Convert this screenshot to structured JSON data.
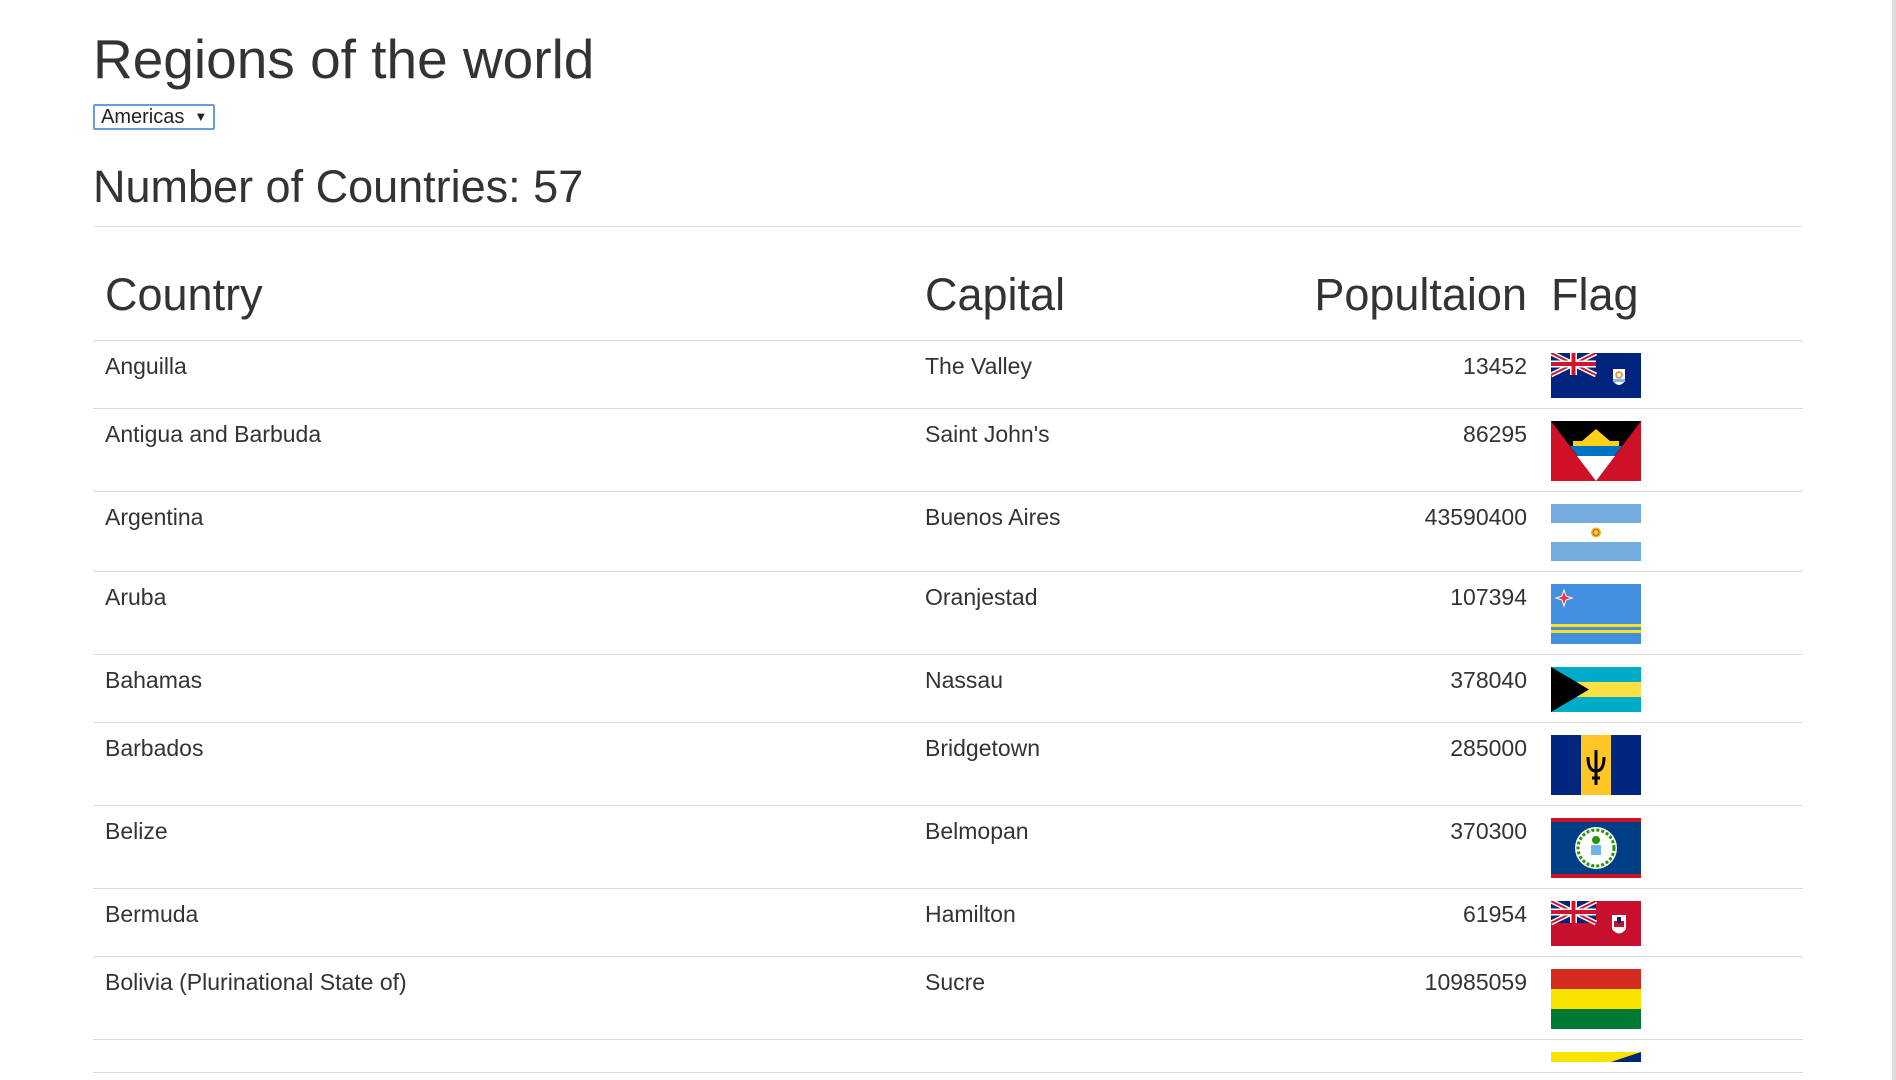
{
  "header": {
    "title": "Regions of the world",
    "region_select": {
      "selected": "Americas"
    },
    "count_label": "Number of Countries: 57"
  },
  "table": {
    "columns": [
      "Country",
      "Capital",
      "Popultaion",
      "Flag"
    ],
    "rows": [
      {
        "country": "Anguilla",
        "capital": "The Valley",
        "population": "13452",
        "flag": "anguilla-flag"
      },
      {
        "country": "Antigua and Barbuda",
        "capital": "Saint John's",
        "population": "86295",
        "flag": "antigua-and-barbuda-flag"
      },
      {
        "country": "Argentina",
        "capital": "Buenos Aires",
        "population": "43590400",
        "flag": "argentina-flag"
      },
      {
        "country": "Aruba",
        "capital": "Oranjestad",
        "population": "107394",
        "flag": "aruba-flag"
      },
      {
        "country": "Bahamas",
        "capital": "Nassau",
        "population": "378040",
        "flag": "bahamas-flag"
      },
      {
        "country": "Barbados",
        "capital": "Bridgetown",
        "population": "285000",
        "flag": "barbados-flag"
      },
      {
        "country": "Belize",
        "capital": "Belmopan",
        "population": "370300",
        "flag": "belize-flag"
      },
      {
        "country": "Bermuda",
        "capital": "Hamilton",
        "population": "61954",
        "flag": "bermuda-flag"
      },
      {
        "country": "Bolivia (Plurinational State of)",
        "capital": "Sucre",
        "population": "10985059",
        "flag": "bolivia-flag"
      }
    ]
  },
  "colors": {
    "select_border": "#6e9bdf",
    "rule": "#e2e2e2",
    "text": "#333333"
  }
}
